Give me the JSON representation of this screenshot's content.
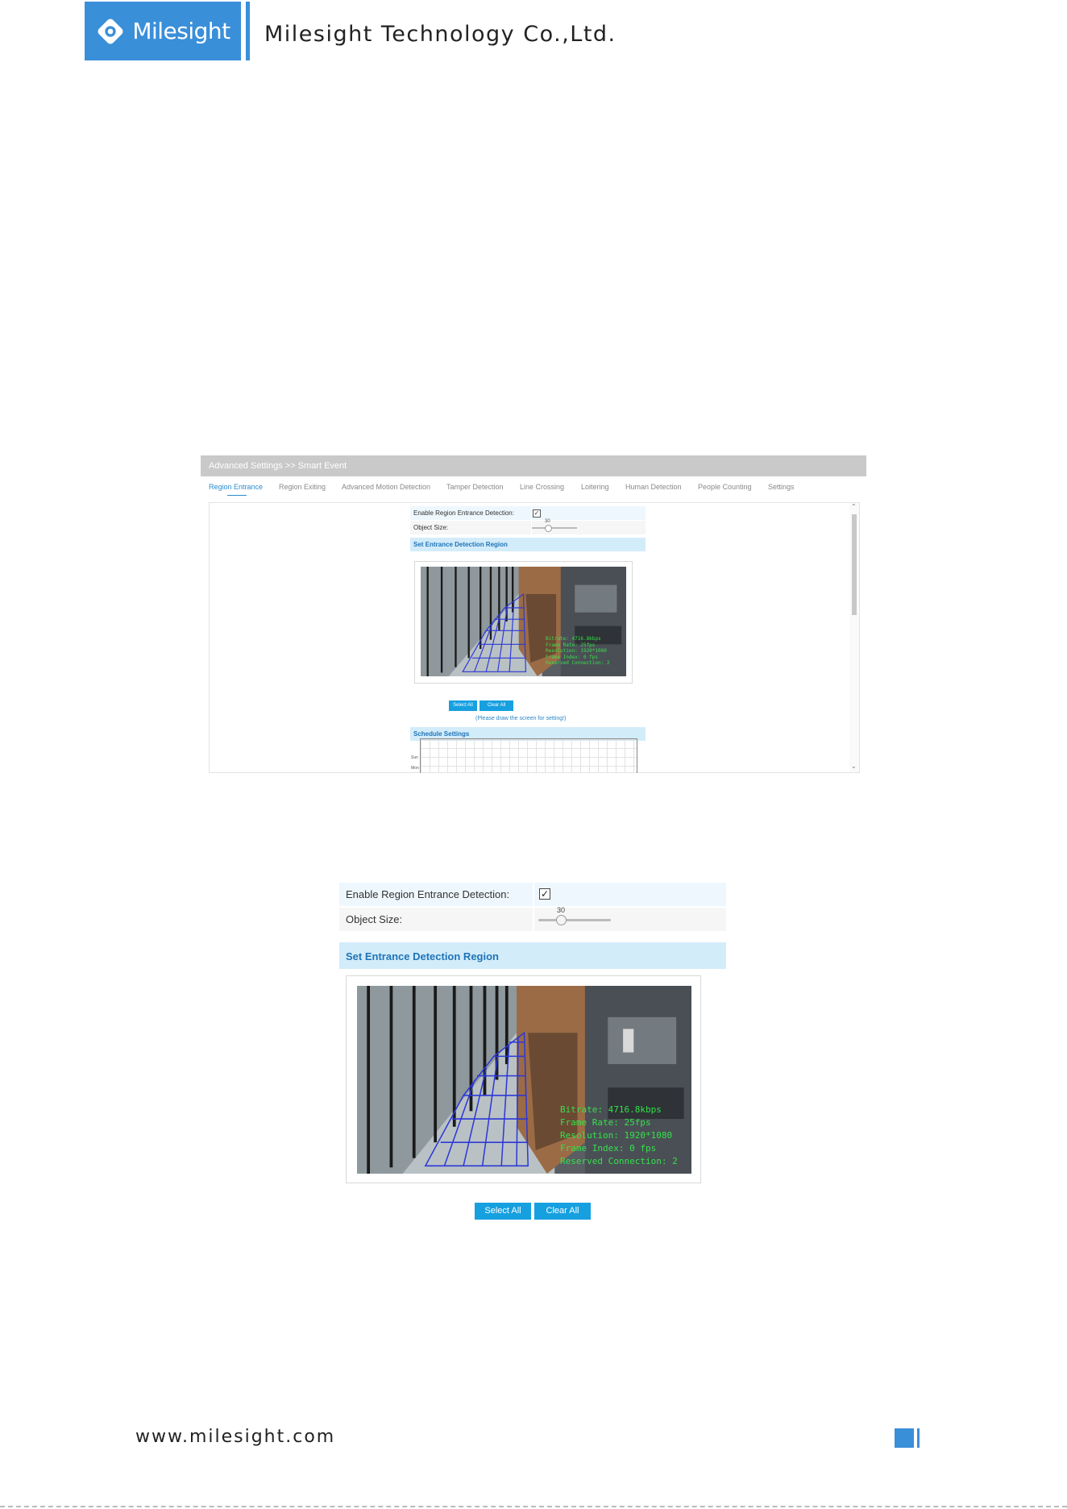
{
  "header": {
    "logo_text": "Milesight",
    "company": "Milesight Technology Co.,Ltd."
  },
  "small_screenshot": {
    "title": "Advanced Settings >> Smart Event",
    "tabs": [
      {
        "label": "Region Entrance",
        "active": true
      },
      {
        "label": "Region Exiting"
      },
      {
        "label": "Advanced Motion Detection"
      },
      {
        "label": "Tamper Detection"
      },
      {
        "label": "Line Crossing"
      },
      {
        "label": "Loitering"
      },
      {
        "label": "Human Detection"
      },
      {
        "label": "People Counting"
      },
      {
        "label": "Settings"
      }
    ],
    "enable_label": "Enable Region Entrance Detection:",
    "enable_checked": true,
    "object_size_label": "Object Size:",
    "object_size_value": "30",
    "region_section": "Set Entrance Detection Region",
    "select_all": "Select All",
    "clear_all": "Clear All",
    "hint": "(Please draw the screen for setting!)",
    "schedule_section": "Schedule Settings",
    "schedule_days": [
      "Sun",
      "Mon"
    ]
  },
  "zoomed": {
    "enable_label": "Enable Region Entrance Detection:",
    "enable_checked": true,
    "object_size_label": "Object Size:",
    "object_size_value": "30",
    "region_section": "Set Entrance Detection Region",
    "select_all": "Select All",
    "clear_all": "Clear All"
  },
  "camera_osd": [
    "Bitrate: 4716.8kbps",
    "Frame Rate: 25fps",
    "Resolution: 1920*1080",
    "Frame Index: 0 fps",
    "Reserved Connection: 2"
  ],
  "footer": {
    "url": "www.milesight.com"
  },
  "colors": {
    "brand": "#3a8fd9",
    "button": "#16a0e0",
    "section_bg": "#d3ecfa",
    "row_bg": "#eef7fd",
    "osd": "#34e24a",
    "grid": "#2c38d8"
  }
}
